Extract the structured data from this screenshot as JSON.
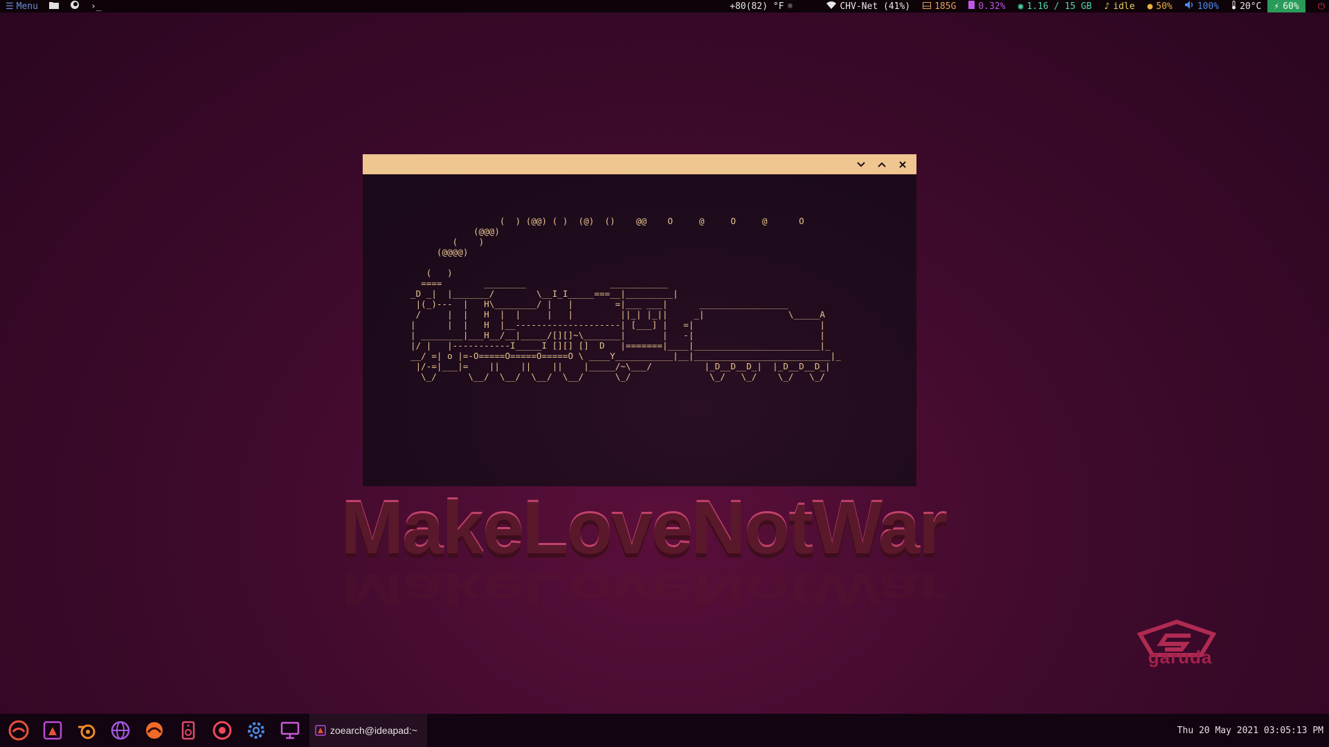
{
  "topbar": {
    "menu_label": "Menu",
    "weather": "+80(82) °F",
    "wifi": "CHV-Net (41%)",
    "disk": "185G",
    "cpu": "0.32%",
    "memory": "1.16 / 15 GB",
    "mpd_status": "idle",
    "brightness": "50%",
    "volume": "100%",
    "temperature": "20°C",
    "battery": "60%"
  },
  "window": {
    "ascii_art": "                 (  ) (@@) ( )  (@)  ()    @@    O     @     O     @      O\n            (@@@)\n        (    )\n     (@@@@)\n\n   (   )\n  ====        ________                ___________\n_D _|  |_______/        \\__I_I_____===__|_________|\n |(_)---  |   H\\________/ |   |        =|___ ___|      _________________\n /     |  |   H  |  |     |   |         ||_| |_||     _|                \\_____A\n|      |  |   H  |__--------------------| [___] |   =|                        |\n| ________|___H__/__|_____/[][]~\\_______|       |   -|                        |\n|/ |   |-----------I_____I [][] []  D   |=======|____|________________________|_\n__/ =| o |=-O=====O=====O=====O \\ ____Y___________|__|__________________________|_\n |/-=|___|=    ||    ||    ||    |_____/~\\___/          |_D__D__D_|  |_D__D__D_|\n  \\_/      \\__/  \\__/  \\__/  \\__/      \\_/               \\_/   \\_/    \\_/   \\_/"
  },
  "wallpaper": {
    "slogan": "MakeLoveNotWar",
    "logo_text": "garuda"
  },
  "taskbar": {
    "launchers": [
      {
        "name": "garuda-menu-icon",
        "color": "#e8533a"
      },
      {
        "name": "garuda-assistant-icon",
        "color": "#b84ad8"
      },
      {
        "name": "blender-icon",
        "color": "#f08a2a"
      },
      {
        "name": "web-browser-icon",
        "color": "#a45ae0"
      },
      {
        "name": "firedragon-icon",
        "color": "#f06a2a"
      },
      {
        "name": "audio-player-icon",
        "color": "#e04a6a"
      },
      {
        "name": "record-app-icon",
        "color": "#f0485a"
      },
      {
        "name": "settings-icon",
        "color": "#4a8ae0"
      },
      {
        "name": "display-settings-icon",
        "color": "#c85ad8"
      }
    ],
    "active_task": "zoearch@ideapad:~",
    "clock": "Thu 20 May 2021 03:05:13 PM"
  },
  "colors": {
    "titlebar": "#efc590",
    "ascii": "#e9c58f",
    "cpu": "#c056e8",
    "memory": "#4ad8b0",
    "volume": "#4a8ae8",
    "battery_bg": "#2a9a5a",
    "accent_red": "#e0304a"
  }
}
